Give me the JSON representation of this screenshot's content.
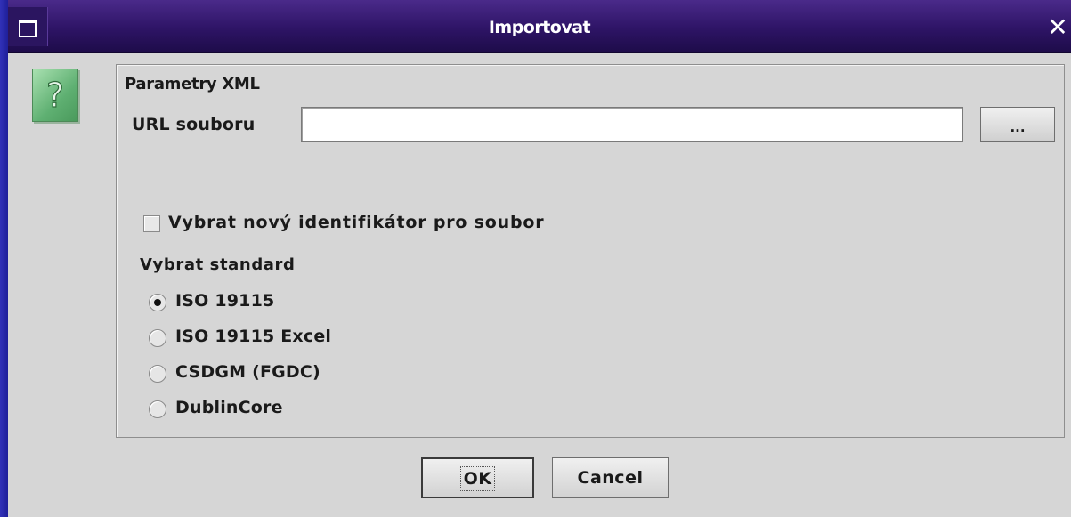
{
  "window": {
    "title": "Importovat",
    "close_symbol": "✕"
  },
  "icons": {
    "window_menu": "window-menu-icon",
    "help": "question-icon",
    "help_glyph": "?"
  },
  "panel": {
    "title": "Parametry XML",
    "url_label": "URL souboru",
    "url_value": "",
    "browse_label": "...",
    "checkbox_label": "Vybrat nový identifikátor pro soubor",
    "checkbox_checked": false,
    "standard_label": "Vybrat standard",
    "standards": [
      {
        "label": "ISO 19115",
        "selected": true
      },
      {
        "label": "ISO 19115 Excel",
        "selected": false
      },
      {
        "label": "CSDGM (FGDC)",
        "selected": false
      },
      {
        "label": "DublinCore",
        "selected": false
      }
    ]
  },
  "buttons": {
    "ok_label": "OK",
    "cancel_label": "Cancel"
  },
  "colors": {
    "desktop": "#2a2aa8",
    "titlebar": "#2e1466",
    "dialog_bg": "#d6d6d6",
    "help_icon": "#5fb072"
  }
}
